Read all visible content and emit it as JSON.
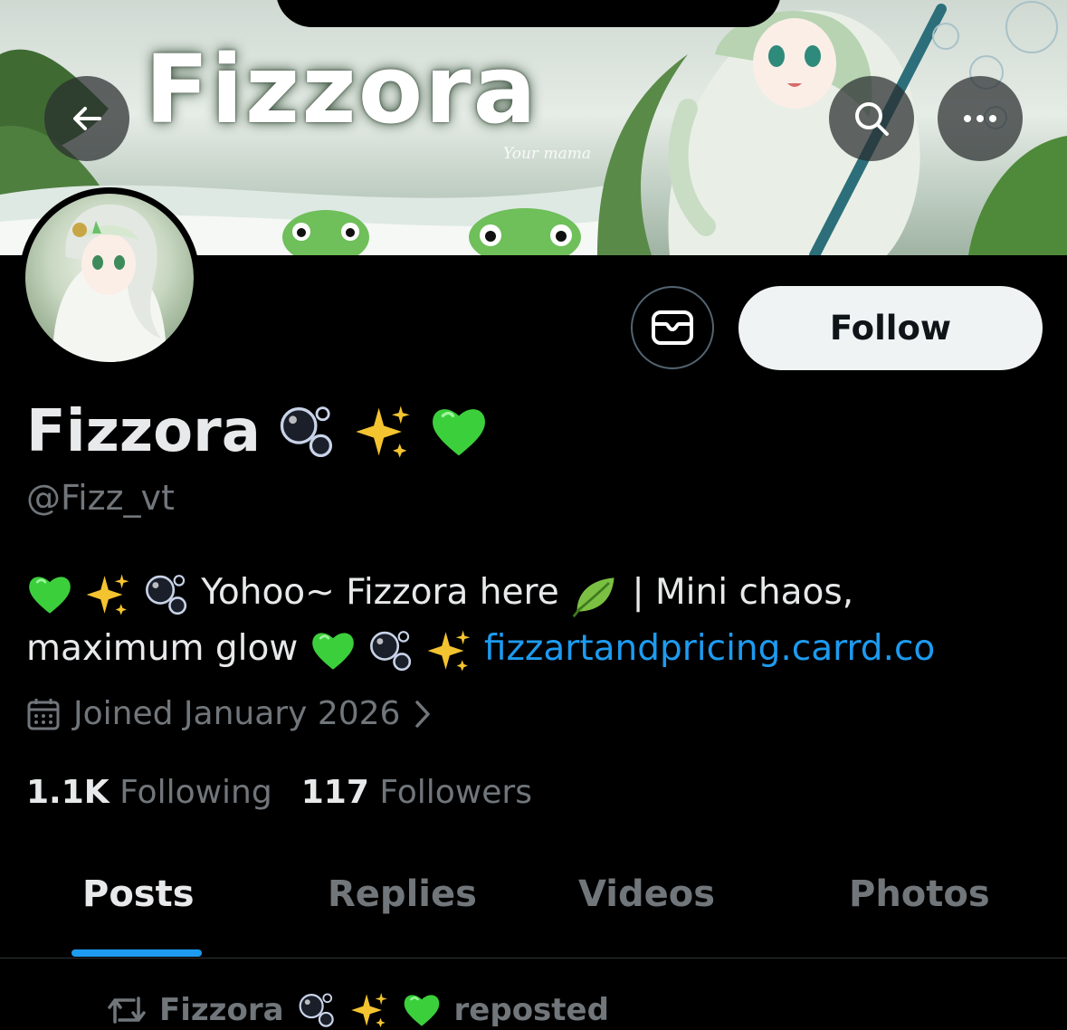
{
  "banner": {
    "logo_text": "Fizzora",
    "signature": "Your mama"
  },
  "actions": {
    "follow_label": "Follow"
  },
  "profile": {
    "display_name": "Fizzora",
    "handle": "@Fizz_vt",
    "bio_text_1": "Yohoo~ Fizzora here",
    "bio_text_2": "| Mini chaos,",
    "bio_text_3": "maximum glow",
    "bio_link": "fizzartandpricing.carrd.co",
    "joined": "Joined January 2026",
    "following_count": "1.1K",
    "following_label": "Following",
    "followers_count": "117",
    "followers_label": "Followers"
  },
  "tabs": [
    {
      "label": "Posts",
      "active": true
    },
    {
      "label": "Replies",
      "active": false
    },
    {
      "label": "Videos",
      "active": false
    },
    {
      "label": "Photos",
      "active": false
    }
  ],
  "feed": {
    "repost_name": "Fizzora",
    "repost_label": "reposted"
  },
  "icons": {
    "back": "arrow-left-icon",
    "search": "search-icon",
    "more": "more-icon",
    "mail": "mail-icon",
    "calendar": "calendar-icon",
    "chevron": "chevron-right-icon",
    "repost": "repost-icon"
  },
  "colors": {
    "background": "#000000",
    "link": "#1d9bf0",
    "muted": "#71767b",
    "text": "#e7e9ea",
    "follow_bg": "#eff3f4",
    "heart": "#3ccf3c",
    "sparkle": "#f4c430"
  }
}
